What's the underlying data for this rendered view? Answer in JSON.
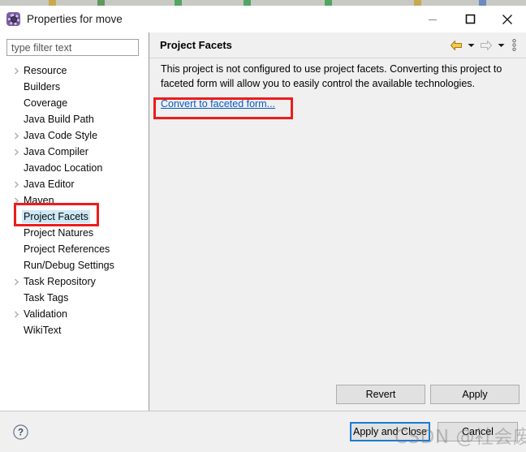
{
  "window": {
    "title": "Properties for move",
    "app_icon": "properties-gear-icon",
    "controls": {
      "minimize": "minimize-icon",
      "maximize": "maximize-icon",
      "close": "close-icon"
    }
  },
  "sidebar": {
    "filter": {
      "value": "",
      "placeholder": "type filter text"
    },
    "items": [
      {
        "label": "Resource",
        "expandable": true,
        "selected": false
      },
      {
        "label": "Builders",
        "expandable": false,
        "selected": false
      },
      {
        "label": "Coverage",
        "expandable": false,
        "selected": false
      },
      {
        "label": "Java Build Path",
        "expandable": false,
        "selected": false
      },
      {
        "label": "Java Code Style",
        "expandable": true,
        "selected": false
      },
      {
        "label": "Java Compiler",
        "expandable": true,
        "selected": false
      },
      {
        "label": "Javadoc Location",
        "expandable": false,
        "selected": false
      },
      {
        "label": "Java Editor",
        "expandable": true,
        "selected": false
      },
      {
        "label": "Maven",
        "expandable": true,
        "selected": false
      },
      {
        "label": "Project Facets",
        "expandable": false,
        "selected": true
      },
      {
        "label": "Project Natures",
        "expandable": false,
        "selected": false
      },
      {
        "label": "Project References",
        "expandable": false,
        "selected": false
      },
      {
        "label": "Run/Debug Settings",
        "expandable": false,
        "selected": false
      },
      {
        "label": "Task Repository",
        "expandable": true,
        "selected": false
      },
      {
        "label": "Task Tags",
        "expandable": false,
        "selected": false
      },
      {
        "label": "Validation",
        "expandable": true,
        "selected": false
      },
      {
        "label": "WikiText",
        "expandable": false,
        "selected": false
      }
    ]
  },
  "page": {
    "title": "Project Facets",
    "toolbar": {
      "back": "back-arrow-icon",
      "back_menu": "chevron-down-icon",
      "forward": "forward-arrow-icon",
      "forward_menu": "chevron-down-icon",
      "view_menu": "vertical-dots-icon"
    },
    "description": "This project is not configured to use project facets. Converting this project to faceted form will allow you to easily control the available technologies.",
    "link": "Convert to faceted form...",
    "revert_label": "Revert",
    "apply_label": "Apply"
  },
  "footer": {
    "help": "help-icon",
    "apply_and_close_label": "Apply and Close",
    "cancel_label": "Cancel"
  },
  "overlay": {
    "watermark": "CSDN @社会废人"
  },
  "colors": {
    "selection": "#cde8f6",
    "link": "#0b5bc4",
    "annotation": "#ee1c1c",
    "focus_border": "#1a7bd4",
    "dialog_bg": "#f0f0f0",
    "tree_bg": "#ffffff"
  }
}
